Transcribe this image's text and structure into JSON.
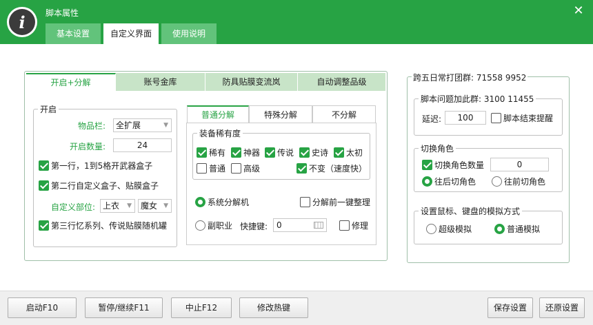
{
  "window": {
    "title": "脚本属性",
    "logo_glyph": "i",
    "close_glyph": "✕"
  },
  "top_tabs": [
    {
      "label": "基本设置",
      "active": false
    },
    {
      "label": "自定义界面",
      "active": true
    },
    {
      "label": "使用说明",
      "active": false
    }
  ],
  "sub_tabs": [
    {
      "label": "开启+分解",
      "active": true
    },
    {
      "label": "账号金库",
      "active": false
    },
    {
      "label": "防具贴膜变流岚",
      "active": false
    },
    {
      "label": "自动调整品级",
      "active": false
    }
  ],
  "open_group": {
    "legend": "开启",
    "inventory_label": "物品栏:",
    "inventory_value": "全扩展",
    "open_count_label": "开启数量:",
    "open_count_value": "24",
    "row1": {
      "label": "第一行，1到5格开武器盒子",
      "checked": true
    },
    "row2": {
      "label": "第二行自定义盒子、贴膜盒子",
      "checked": true
    },
    "custom_part_label": "自定义部位:",
    "custom_part_value1": "上衣",
    "custom_part_value2": "魔女",
    "row3": {
      "label": "第三行忆系列、传说贴膜随机罐",
      "checked": true
    }
  },
  "inner_tabs": [
    {
      "label": "普通分解",
      "active": true
    },
    {
      "label": "特殊分解",
      "active": false
    },
    {
      "label": "不分解",
      "active": false
    }
  ],
  "rarity_group": {
    "legend": "装备稀有度",
    "items": [
      {
        "label": "稀有",
        "checked": true
      },
      {
        "label": "神器",
        "checked": true
      },
      {
        "label": "传说",
        "checked": true
      },
      {
        "label": "史诗",
        "checked": true
      },
      {
        "label": "太初",
        "checked": true
      },
      {
        "label": "普通",
        "checked": false
      },
      {
        "label": "高级",
        "checked": false
      },
      {
        "label": "不变（速度快）",
        "checked": true
      }
    ]
  },
  "decompose": {
    "system_label": "系统分解机",
    "system_selected": true,
    "tidy_label": "分解前一键整理",
    "tidy_checked": false,
    "subjob_label": "副职业",
    "subjob_selected": false,
    "hotkey_label": "快捷键:",
    "hotkey_value": "0",
    "repair_label": "修理",
    "repair_checked": false
  },
  "right_panel": {
    "group_label": "跨五日常打团群: 71558 9952",
    "issue_group": {
      "legend": "脚本问题加此群: 3100 11455",
      "delay_label": "延迟:",
      "delay_value": "100",
      "end_notify_label": "脚本结束提醒",
      "end_notify_checked": false
    },
    "switch_role": {
      "legend": "切换角色",
      "count_label": "切换角色数量",
      "count_checked": true,
      "count_value": "0",
      "back_label": "往后切角色",
      "back_selected": true,
      "forward_label": "往前切角色",
      "forward_selected": false
    },
    "sim_mode": {
      "legend": "设置鼠标、键盘的模拟方式",
      "super_label": "超级模拟",
      "super_selected": false,
      "normal_label": "普通模拟",
      "normal_selected": true
    }
  },
  "bottom_buttons": {
    "start": "启动F10",
    "pause": "暂停/继续F11",
    "stop": "中止F12",
    "hotkey": "修改热键",
    "save": "保存设置",
    "restore": "还原设置"
  }
}
